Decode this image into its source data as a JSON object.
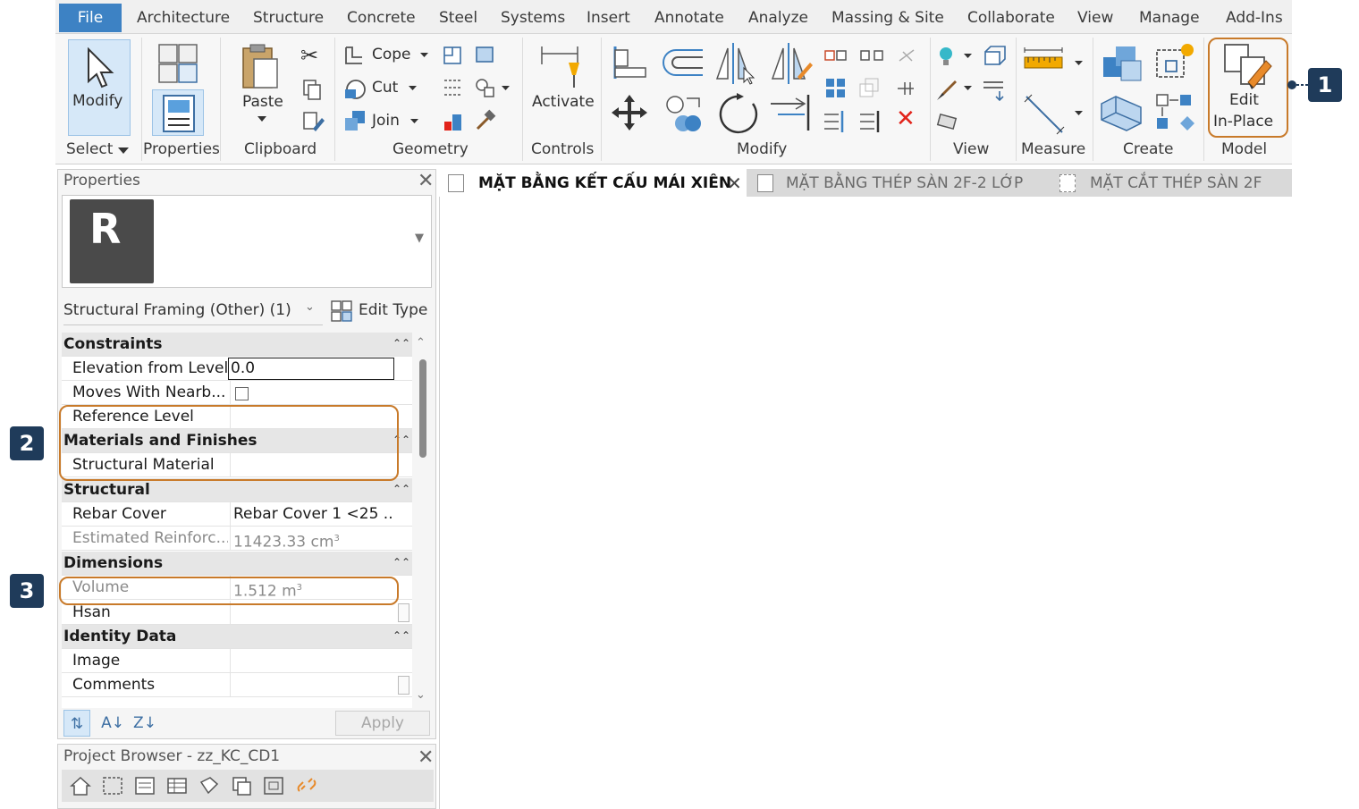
{
  "menu": [
    "File",
    "Architecture",
    "Structure",
    "Concrete",
    "Steel",
    "Systems",
    "Insert",
    "Annotate",
    "Analyze",
    "Massing & Site",
    "Collaborate",
    "View",
    "Manage",
    "Add-Ins"
  ],
  "ribbon": {
    "panels": [
      "Select",
      "Properties",
      "Clipboard",
      "Geometry",
      "Controls",
      "Modify",
      "View",
      "Measure",
      "Create",
      "Model"
    ],
    "tools": {
      "modify": "Modify",
      "paste": "Paste",
      "cope": "Cope",
      "cut": "Cut",
      "join": "Join",
      "activate": "Activate",
      "edit_inplace_1": "Edit",
      "edit_inplace_2": "In-Place"
    }
  },
  "properties": {
    "title": "Properties",
    "type_selector": "Structural Framing (Other) (1)",
    "edit_type": "Edit Type",
    "logo_letter": "R",
    "categories": {
      "constraints": "Constraints",
      "materials": "Materials and Finishes",
      "structural": "Structural",
      "dimensions": "Dimensions",
      "identity": "Identity Data"
    },
    "rows": {
      "elevation": {
        "label": "Elevation from Level",
        "value": "0.0"
      },
      "moves_with": {
        "label": "Moves With Nearb...",
        "checked": false
      },
      "ref_level": {
        "label": "Reference Level",
        "value": ""
      },
      "struct_material": {
        "label": "Structural Material",
        "value": ""
      },
      "rebar_cover": {
        "label": "Rebar Cover",
        "value": "Rebar Cover 1 <25 ..."
      },
      "est_reinf": {
        "label": "Estimated Reinforc...",
        "value": "11423.33 cm",
        "unit_sup": "3"
      },
      "volume": {
        "label": "Volume",
        "value": "1.512 m",
        "unit_sup": "3"
      },
      "hsan": {
        "label": "Hsan",
        "value": ""
      },
      "image": {
        "label": "Image",
        "value": ""
      },
      "comments": {
        "label": "Comments",
        "value": ""
      }
    },
    "apply": "Apply"
  },
  "browser": {
    "title": "Project Browser - zz_KC_CD1"
  },
  "tabs": [
    {
      "label": "MẶT BẰNG KẾT CẤU MÁI XIÊN",
      "active": true
    },
    {
      "label": "MẶT BẰNG THÉP SÀN 2F-2 LỚP",
      "active": false
    },
    {
      "label": "MẶT CẮT THÉP SÀN 2F",
      "active": false
    }
  ],
  "callouts": [
    "1",
    "2",
    "3"
  ],
  "colors": {
    "callout_bg": "#1f3b5a",
    "highlight": "#c87a2a",
    "file_tab": "#3d82c4",
    "selected_bg": "#d6e8f8"
  }
}
